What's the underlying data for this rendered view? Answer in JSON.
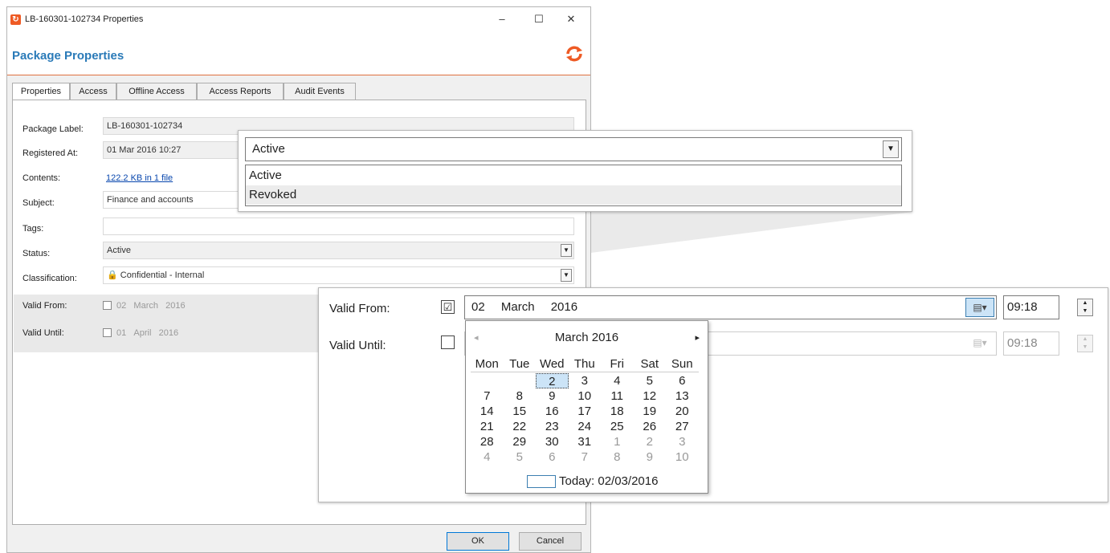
{
  "window": {
    "title": "LB-160301-102734 Properties",
    "app_icon": "package-icon",
    "controls": [
      "–",
      "☐",
      "✕"
    ],
    "header_title": "Package Properties",
    "logo_icon": "sync-logo-icon"
  },
  "tabs": [
    {
      "label": "Properties",
      "active": true
    },
    {
      "label": "Access",
      "active": false
    },
    {
      "label": "Offline Access",
      "active": false
    },
    {
      "label": "Access Reports",
      "active": false
    },
    {
      "label": "Audit Events",
      "active": false
    }
  ],
  "form": {
    "package_label": {
      "label": "Package Label:",
      "value": "LB-160301-102734"
    },
    "registered_at": {
      "label": "Registered At:",
      "value": "01 Mar 2016 10:27"
    },
    "contents": {
      "label": "Contents:",
      "value": "122.2 KB in 1 file"
    },
    "subject": {
      "label": "Subject:",
      "value": "Finance and accounts"
    },
    "tags": {
      "label": "Tags:",
      "value": ""
    },
    "status": {
      "label": "Status:",
      "value": "Active"
    },
    "classification": {
      "label": "Classification:",
      "value": "Confidential - Internal",
      "icon": "lock-icon"
    },
    "valid_from": {
      "label": "Valid From:",
      "day": "02",
      "month": "March",
      "year": "2016"
    },
    "valid_until": {
      "label": "Valid Until:",
      "day": "01",
      "month": "April",
      "year": "2016"
    }
  },
  "buttons": {
    "ok": "OK",
    "cancel": "Cancel"
  },
  "status_zoom": {
    "selected": "Active",
    "options": [
      "Active",
      "Revoked"
    ]
  },
  "validity_zoom": {
    "valid_from_label": "Valid From:",
    "valid_until_label": "Valid Until:",
    "valid_from_checked": true,
    "valid_until_checked": false,
    "from_day": "02",
    "from_month": "March",
    "from_year": "2016",
    "from_time": "09:18",
    "until_time": "09:18",
    "check_mark": "☑"
  },
  "calendar": {
    "title": "March 2016",
    "prev_icon": "◂",
    "next_icon": "▸",
    "weekdays": [
      "Mon",
      "Tue",
      "Wed",
      "Thu",
      "Fri",
      "Sat",
      "Sun"
    ],
    "weeks": [
      [
        null,
        null,
        {
          "d": "2",
          "sel": true
        },
        {
          "d": "3"
        },
        {
          "d": "4"
        },
        {
          "d": "5"
        },
        {
          "d": "6"
        }
      ],
      [
        {
          "d": "7"
        },
        {
          "d": "8"
        },
        {
          "d": "9"
        },
        {
          "d": "10"
        },
        {
          "d": "11"
        },
        {
          "d": "12"
        },
        {
          "d": "13"
        }
      ],
      [
        {
          "d": "14"
        },
        {
          "d": "15"
        },
        {
          "d": "16"
        },
        {
          "d": "17"
        },
        {
          "d": "18"
        },
        {
          "d": "19"
        },
        {
          "d": "20"
        }
      ],
      [
        {
          "d": "21"
        },
        {
          "d": "22"
        },
        {
          "d": "23"
        },
        {
          "d": "24"
        },
        {
          "d": "25"
        },
        {
          "d": "26"
        },
        {
          "d": "27"
        }
      ],
      [
        {
          "d": "28"
        },
        {
          "d": "29"
        },
        {
          "d": "30"
        },
        {
          "d": "31"
        },
        {
          "d": "1",
          "other": true
        },
        {
          "d": "2",
          "other": true
        },
        {
          "d": "3",
          "other": true
        }
      ],
      [
        {
          "d": "4",
          "other": true
        },
        {
          "d": "5",
          "other": true
        },
        {
          "d": "6",
          "other": true
        },
        {
          "d": "7",
          "other": true
        },
        {
          "d": "8",
          "other": true
        },
        {
          "d": "9",
          "other": true
        },
        {
          "d": "10",
          "other": true
        }
      ]
    ],
    "today_label": "Today: 02/03/2016"
  },
  "colors": {
    "accent": "#2a7ab8",
    "brand": "#ee5a24",
    "link": "#0645ad",
    "selection": "#cce4f7"
  }
}
